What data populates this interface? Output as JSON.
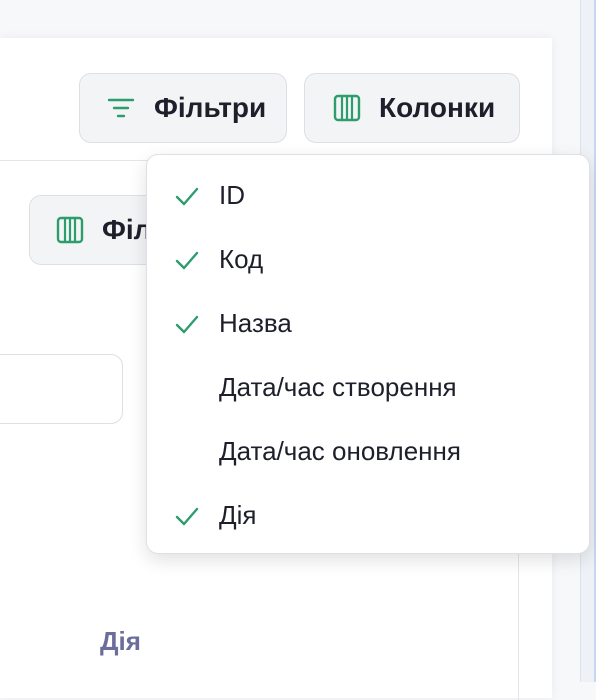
{
  "toolbar": {
    "filters_label": "Фільтри",
    "columns_label": "Колонки",
    "filters_icon": "filter-lines-icon",
    "columns_icon": "columns-icon"
  },
  "background": {
    "partial_button_label": "Філ",
    "column_header": "Дія"
  },
  "columns_menu": {
    "items": [
      {
        "label": "ID",
        "checked": true
      },
      {
        "label": "Код",
        "checked": true
      },
      {
        "label": "Назва",
        "checked": true
      },
      {
        "label": "Дата/час створення",
        "checked": false
      },
      {
        "label": "Дата/час оновлення",
        "checked": false
      },
      {
        "label": "Дія",
        "checked": true
      }
    ]
  },
  "colors": {
    "accent_green": "#2e9d6e",
    "header_text": "#6b6e9a"
  }
}
